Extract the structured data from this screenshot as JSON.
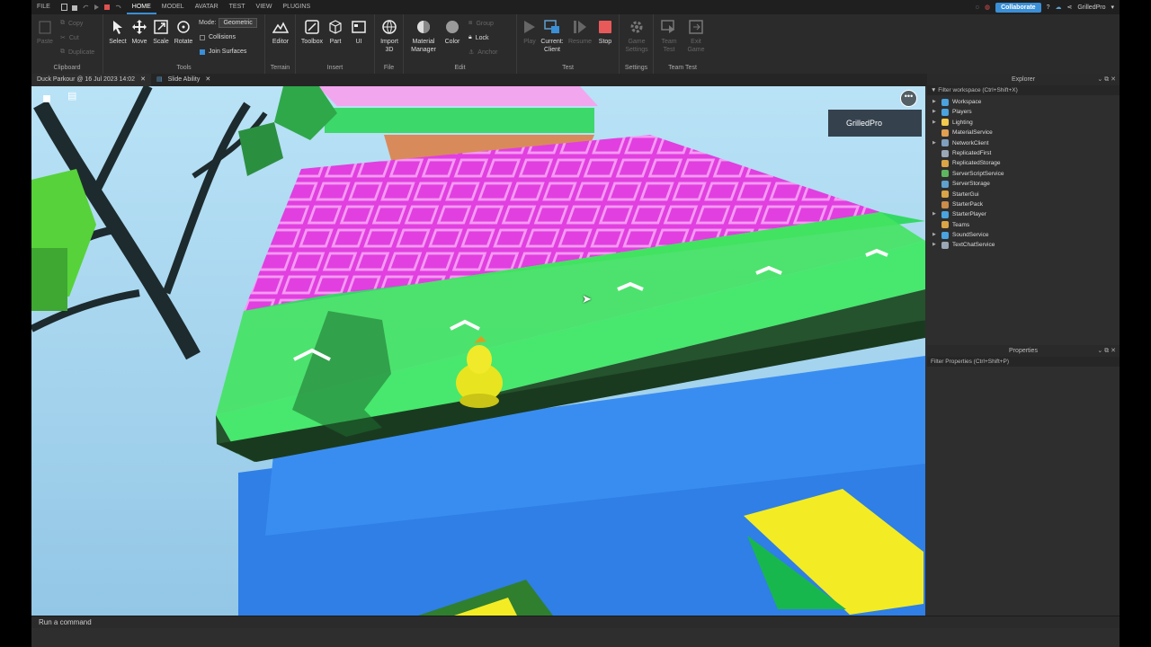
{
  "menu": {
    "file": "FILE",
    "tabs": [
      "HOME",
      "MODEL",
      "AVATAR",
      "TEST",
      "VIEW",
      "PLUGINS"
    ],
    "active_tab": "HOME",
    "collaborate": "Collaborate",
    "username": "GrilledPro"
  },
  "ribbon": {
    "clipboard": {
      "label": "Clipboard",
      "paste": "Paste",
      "copy": "Copy",
      "cut": "Cut",
      "duplicate": "Duplicate"
    },
    "tools": {
      "label": "Tools",
      "select": "Select",
      "move": "Move",
      "scale": "Scale",
      "rotate": "Rotate",
      "mode_label": "Mode:",
      "mode_value": "Geometric",
      "collisions": "Collisions",
      "join_surfaces": "Join Surfaces"
    },
    "terrain": {
      "label": "Terrain",
      "editor": "Editor"
    },
    "insert": {
      "label": "Insert",
      "toolbox": "Toolbox",
      "part": "Part",
      "ui": "UI"
    },
    "file": {
      "label": "File",
      "import": "Import",
      "import_sub": "3D"
    },
    "edit": {
      "label": "Edit",
      "material": "Material",
      "material_sub": "Manager",
      "color": "Color",
      "group": "Group",
      "lock": "Lock",
      "anchor": "Anchor"
    },
    "test": {
      "label": "Test",
      "play": "Play",
      "current": "Current:",
      "current_sub": "Client",
      "resume": "Resume",
      "stop": "Stop"
    },
    "settings": {
      "label": "Settings",
      "game": "Game",
      "game_sub": "Settings"
    },
    "team_test": {
      "label": "Team Test",
      "team": "Team",
      "team_sub": "Test",
      "exit": "Exit",
      "exit_sub": "Game"
    }
  },
  "doc_tabs": [
    {
      "label": "Duck Parkour @ 16 Jul 2023 14:02"
    },
    {
      "label": "Slide Ability"
    }
  ],
  "viewport": {
    "player_name": "GrilledPro",
    "menu_dots": "•••"
  },
  "command_bar": {
    "placeholder": "Run a command"
  },
  "explorer": {
    "title": "Explorer",
    "filter": "Filter workspace (Ctrl+Shift+X)",
    "items": [
      {
        "label": "Workspace",
        "expandable": true,
        "color": "#4aa3df"
      },
      {
        "label": "Players",
        "expandable": true,
        "color": "#4aa3df"
      },
      {
        "label": "Lighting",
        "expandable": true,
        "color": "#f2c94c"
      },
      {
        "label": "MaterialService",
        "expandable": false,
        "color": "#e0a050"
      },
      {
        "label": "NetworkClient",
        "expandable": true,
        "color": "#7f9fbf"
      },
      {
        "label": "ReplicatedFirst",
        "expandable": false,
        "color": "#9aa7b5"
      },
      {
        "label": "ReplicatedStorage",
        "expandable": false,
        "color": "#d9a546"
      },
      {
        "label": "ServerScriptService",
        "expandable": false,
        "color": "#5fb55f"
      },
      {
        "label": "ServerStorage",
        "expandable": false,
        "color": "#5fa0d0"
      },
      {
        "label": "StarterGui",
        "expandable": false,
        "color": "#d9a546"
      },
      {
        "label": "StarterPack",
        "expandable": false,
        "color": "#c98c4a"
      },
      {
        "label": "StarterPlayer",
        "expandable": true,
        "color": "#4aa3df"
      },
      {
        "label": "Teams",
        "expandable": false,
        "color": "#d9a546"
      },
      {
        "label": "SoundService",
        "expandable": true,
        "color": "#4aa3df"
      },
      {
        "label": "TextChatService",
        "expandable": true,
        "color": "#9aa7b5"
      }
    ]
  },
  "properties": {
    "title": "Properties",
    "filter": "Filter Properties (Ctrl+Shift+P)"
  }
}
